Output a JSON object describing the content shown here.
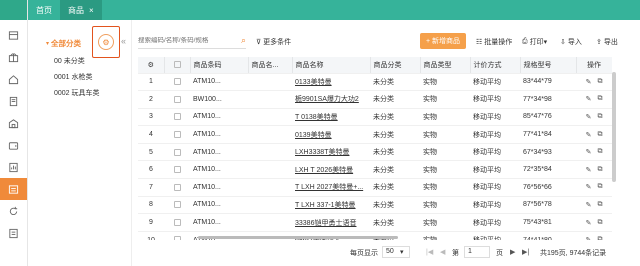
{
  "tabs": [
    {
      "label": "首页"
    },
    {
      "label": "商品",
      "close": "×"
    }
  ],
  "category": {
    "title": "全部分类",
    "items": [
      "00 未分类",
      "0001 水枪类",
      "0002 玩具车类"
    ]
  },
  "toolbar": {
    "search_placeholder": "搜索编码/名称/条码/规格",
    "more_filters": "更多条件",
    "new_button": "+ 新增商品",
    "batch": "批量操作",
    "print": "打印",
    "import": "导入",
    "export": "导出"
  },
  "table": {
    "headers": [
      "",
      "",
      "商品条码",
      "商品名...",
      "商品名称",
      "商品分类",
      "商品类型",
      "计价方式",
      "规格型号",
      "操作"
    ],
    "rows": [
      {
        "no": "1",
        "code": "ATM10...",
        "name": "0133美特曼",
        "cat": "未分类",
        "type": "实物",
        "price": "移动平均",
        "spec": "83*44*79"
      },
      {
        "no": "2",
        "code": "BW100...",
        "name": "栀9901SA爆力大功2",
        "cat": "未分类",
        "type": "实物",
        "price": "移动平均",
        "spec": "77*34*98"
      },
      {
        "no": "3",
        "code": "ATM10...",
        "name": "T 0138美特曼",
        "cat": "未分类",
        "type": "实物",
        "price": "移动平均",
        "spec": "85*47*76"
      },
      {
        "no": "4",
        "code": "ATM10...",
        "name": "0139美特曼",
        "cat": "未分类",
        "type": "实物",
        "price": "移动平均",
        "spec": "77*41*84"
      },
      {
        "no": "5",
        "code": "ATM10...",
        "name": "LXH3338T美特曼",
        "cat": "未分类",
        "type": "实物",
        "price": "移动平均",
        "spec": "67*34*93"
      },
      {
        "no": "6",
        "code": "ATM10...",
        "name": "LXH T 2026美特曼",
        "cat": "未分类",
        "type": "实物",
        "price": "移动平均",
        "spec": "72*35*84"
      },
      {
        "no": "7",
        "code": "ATM10...",
        "name": "T LXH 2027美特曼+...",
        "cat": "未分类",
        "type": "实物",
        "price": "移动平均",
        "spec": "76*56*66"
      },
      {
        "no": "8",
        "code": "ATM10...",
        "name": "T LXH 337-1美特曼",
        "cat": "未分类",
        "type": "实物",
        "price": "移动平均",
        "spec": "87*56*78"
      },
      {
        "no": "9",
        "code": "ATM10...",
        "name": "33386铠甲勇士语音",
        "cat": "未分类",
        "type": "实物",
        "price": "移动平均",
        "spec": "75*43*81"
      },
      {
        "no": "10",
        "code": "ATM10...",
        "name": "686-2美国超人",
        "cat": "未分类",
        "type": "实物",
        "price": "移动平均",
        "spec": "74*41*80"
      }
    ]
  },
  "pager": {
    "per_page_label": "每页显示",
    "per_page": "50",
    "page_prefix": "第",
    "page": "1",
    "page_suffix": "页",
    "summary": "共195页, 9744条记录"
  }
}
